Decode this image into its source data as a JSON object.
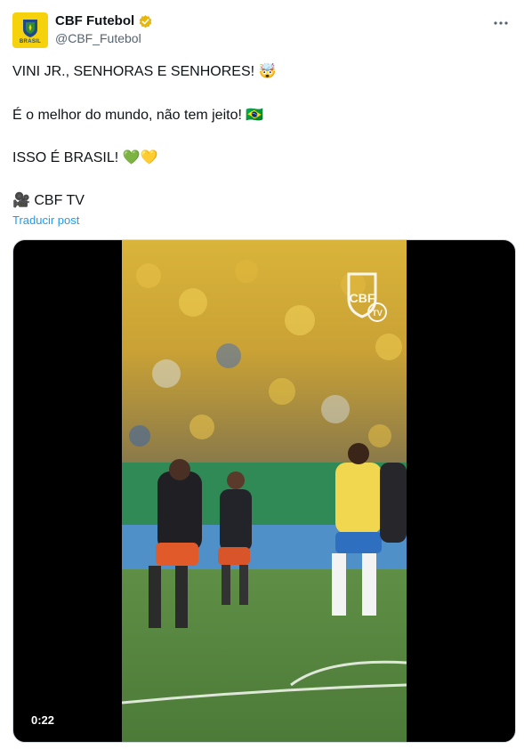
{
  "author": {
    "display_name": "CBF Futebol",
    "handle": "@CBF_Futebol",
    "avatar_text": "BRASIL",
    "verified": true,
    "verified_color": "#e8b70b"
  },
  "more_icon": "more-horizontal-icon",
  "tweet": {
    "line1": "VINI JR., SENHORAS E SENHORES! 🤯",
    "line2": "É o melhor do mundo, não tem jeito! 🇧🇷",
    "line3": "ISSO É BRASIL! 💚💛",
    "line4": "🎥 CBF TV"
  },
  "translate_label": "Traducir post",
  "media": {
    "duration": "0:22",
    "type": "video"
  },
  "colors": {
    "link": "#1d9bf0",
    "secondary_text": "#536471",
    "brand_yellow": "#f5d20b"
  }
}
